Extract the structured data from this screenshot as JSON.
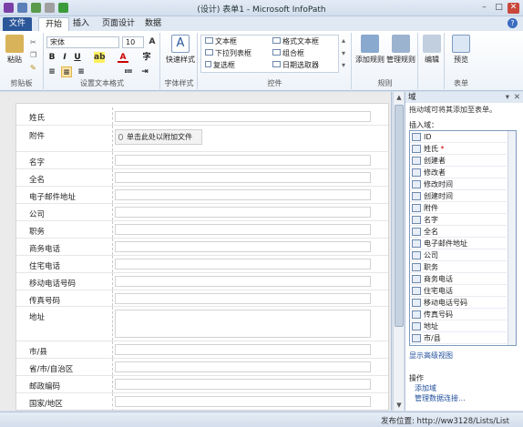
{
  "window": {
    "title": "(设计) 表单1 - Microsoft InfoPath",
    "minimize": "–",
    "maximize": "□",
    "close": "✕"
  },
  "tabs": {
    "file": "文件",
    "home": "开始",
    "insert": "插入",
    "layout": "页面设计",
    "data": "数据",
    "help": "?"
  },
  "ribbon": {
    "clipboard": {
      "paste": "粘贴",
      "label": "剪贴板"
    },
    "font": {
      "family": "宋体",
      "size": "10",
      "bold": "B",
      "italic": "I",
      "underline": "U",
      "label": "设置文本格式"
    },
    "styles": {
      "quick": "快速样式",
      "label": "字体样式"
    },
    "controls": {
      "items": [
        "文本框",
        "格式文本框",
        "下拉列表框",
        "组合框",
        "复选框",
        "日期选取器"
      ],
      "label": "控件"
    },
    "rules": {
      "add": "添加规则",
      "manage": "管理规则",
      "label": "规则"
    },
    "editing": {
      "edit": "编辑"
    },
    "form": {
      "preview": "预览",
      "label": "表单"
    }
  },
  "form": {
    "attach_label": "单击此处以附加文件",
    "fields": [
      "姓氏",
      "附件",
      "名字",
      "全名",
      "电子邮件地址",
      "公司",
      "职务",
      "商务电话",
      "住宅电话",
      "移动电话号码",
      "传真号码",
      "地址",
      "市/县",
      "省/市/自治区",
      "邮政编码",
      "国家/地区"
    ]
  },
  "pane": {
    "title": "域",
    "hint": "拖动域可将其添加至表单。",
    "insert_label": "插入域：",
    "fields": [
      {
        "name": "ID",
        "required": false
      },
      {
        "name": "姓氏",
        "required": true
      },
      {
        "name": "创建者",
        "required": false
      },
      {
        "name": "修改者",
        "required": false
      },
      {
        "name": "修改时间",
        "required": false
      },
      {
        "name": "创建时间",
        "required": false
      },
      {
        "name": "附件",
        "required": false
      },
      {
        "name": "名字",
        "required": false
      },
      {
        "name": "全名",
        "required": false
      },
      {
        "name": "电子邮件地址",
        "required": false
      },
      {
        "name": "公司",
        "required": false
      },
      {
        "name": "职务",
        "required": false
      },
      {
        "name": "商务电话",
        "required": false
      },
      {
        "name": "住宅电话",
        "required": false
      },
      {
        "name": "移动电话号码",
        "required": false
      },
      {
        "name": "传真号码",
        "required": false
      },
      {
        "name": "地址",
        "required": false
      },
      {
        "name": "市/县",
        "required": false
      }
    ],
    "advanced_link": "显示高级视图",
    "ops_title": "操作",
    "add_field": "添加域",
    "manage_connections": "管理数据连接..."
  },
  "status": {
    "publish": "发布位置: http://ww3128/Lists/List"
  }
}
